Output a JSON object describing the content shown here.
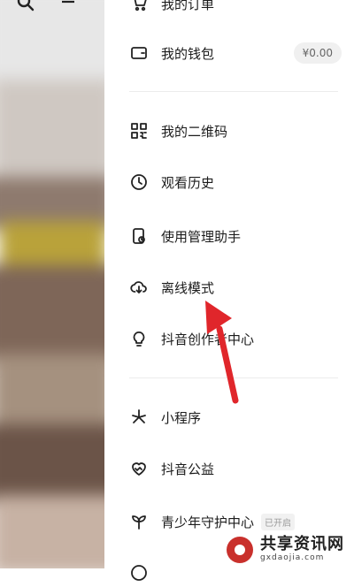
{
  "background": {
    "search_icon": "search-icon",
    "menu_icon": "hamburger-icon"
  },
  "drawer": {
    "items": [
      {
        "label": "我的订单",
        "icon": "cart-icon"
      },
      {
        "label": "我的钱包",
        "icon": "wallet-icon",
        "badge": "¥0.00"
      },
      {
        "label": "我的二维码",
        "icon": "qrcode-icon"
      },
      {
        "label": "观看历史",
        "icon": "clock-icon"
      },
      {
        "label": "使用管理助手",
        "icon": "phone-manage-icon"
      },
      {
        "label": "离线模式",
        "icon": "cloud-download-icon"
      },
      {
        "label": "抖音创作者中心",
        "icon": "bulb-icon"
      },
      {
        "label": "小程序",
        "icon": "asterisk-icon"
      },
      {
        "label": "抖音公益",
        "icon": "heart-icon"
      },
      {
        "label": "青少年守护中心",
        "icon": "sprout-icon",
        "tag": "已开启"
      }
    ]
  },
  "annotation": {
    "arrow_color": "#e0262b"
  },
  "watermark": {
    "name": "共享资讯网",
    "url": "gxdaojia.com"
  }
}
